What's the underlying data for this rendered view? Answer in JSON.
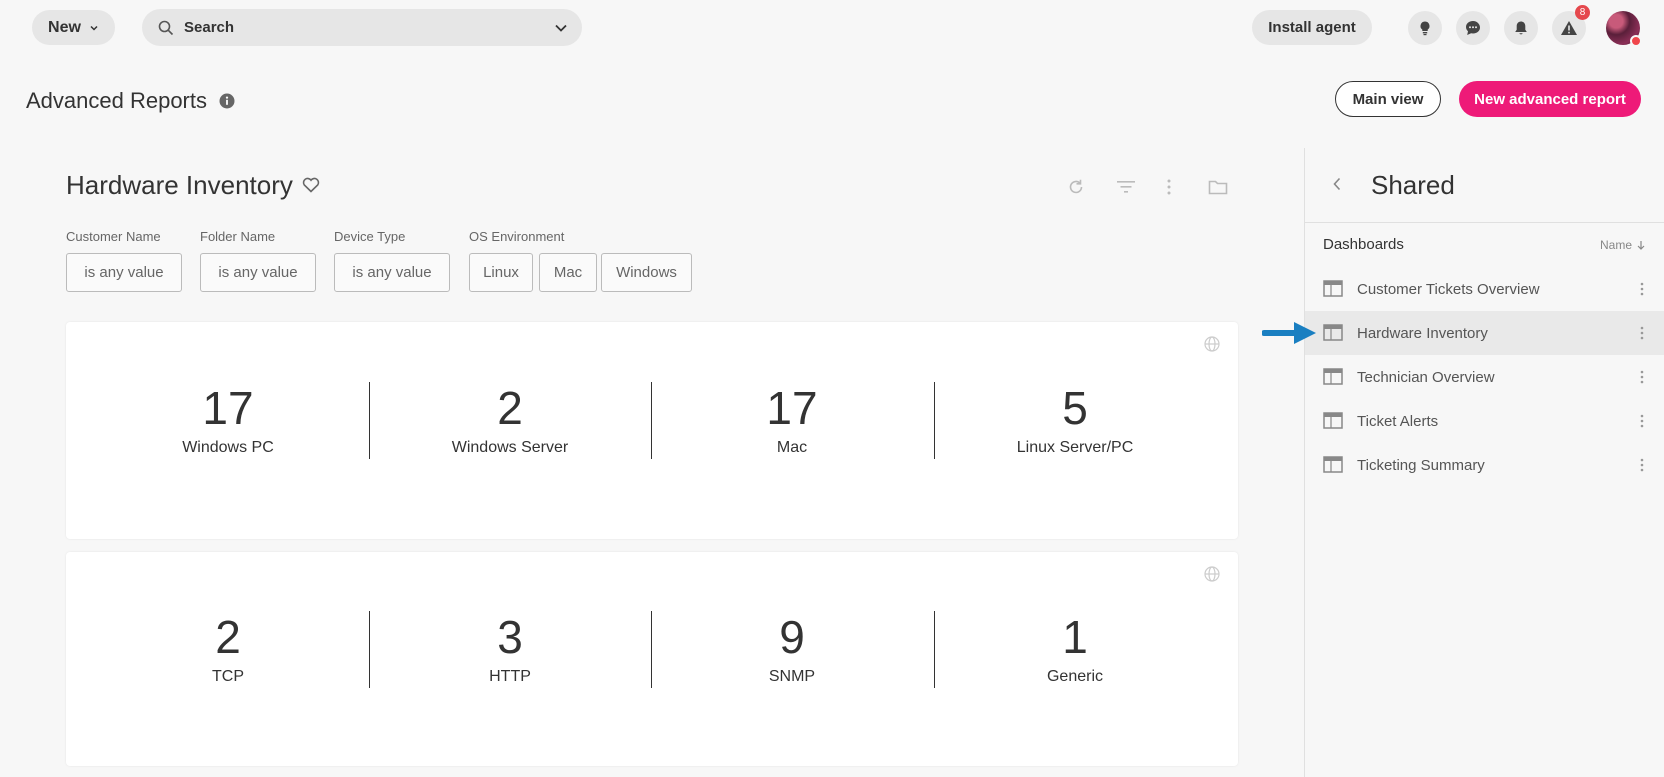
{
  "topbar": {
    "new_label": "New",
    "search_label": "Search",
    "install_label": "Install agent",
    "alerts_badge": "8"
  },
  "header": {
    "title": "Advanced Reports",
    "main_view_label": "Main view",
    "new_report_label": "New advanced report"
  },
  "dashboard": {
    "title": "Hardware Inventory",
    "filters": [
      {
        "label": "Customer Name",
        "values": [
          "is any value"
        ]
      },
      {
        "label": "Folder Name",
        "values": [
          "is any value"
        ]
      },
      {
        "label": "Device Type",
        "values": [
          "is any value"
        ]
      },
      {
        "label": "OS Environment",
        "values": [
          "Linux",
          "Mac",
          "Windows"
        ]
      }
    ],
    "cards": [
      {
        "metrics": [
          {
            "value": "17",
            "label": "Windows PC"
          },
          {
            "value": "2",
            "label": "Windows Server"
          },
          {
            "value": "17",
            "label": "Mac"
          },
          {
            "value": "5",
            "label": "Linux Server/PC"
          }
        ]
      },
      {
        "metrics": [
          {
            "value": "2",
            "label": "TCP"
          },
          {
            "value": "3",
            "label": "HTTP"
          },
          {
            "value": "9",
            "label": "SNMP"
          },
          {
            "value": "1",
            "label": "Generic"
          }
        ]
      }
    ]
  },
  "panel": {
    "title": "Shared",
    "section_label": "Dashboards",
    "sort_label": "Name",
    "items": [
      {
        "name": "Customer Tickets Overview",
        "active": false
      },
      {
        "name": "Hardware Inventory",
        "active": true
      },
      {
        "name": "Technician Overview",
        "active": false
      },
      {
        "name": "Ticket Alerts",
        "active": false
      },
      {
        "name": "Ticketing Summary",
        "active": false
      }
    ]
  },
  "colors": {
    "accent": "#ee1a78",
    "badge": "#e5484d",
    "pointer": "#1a7fc1"
  }
}
